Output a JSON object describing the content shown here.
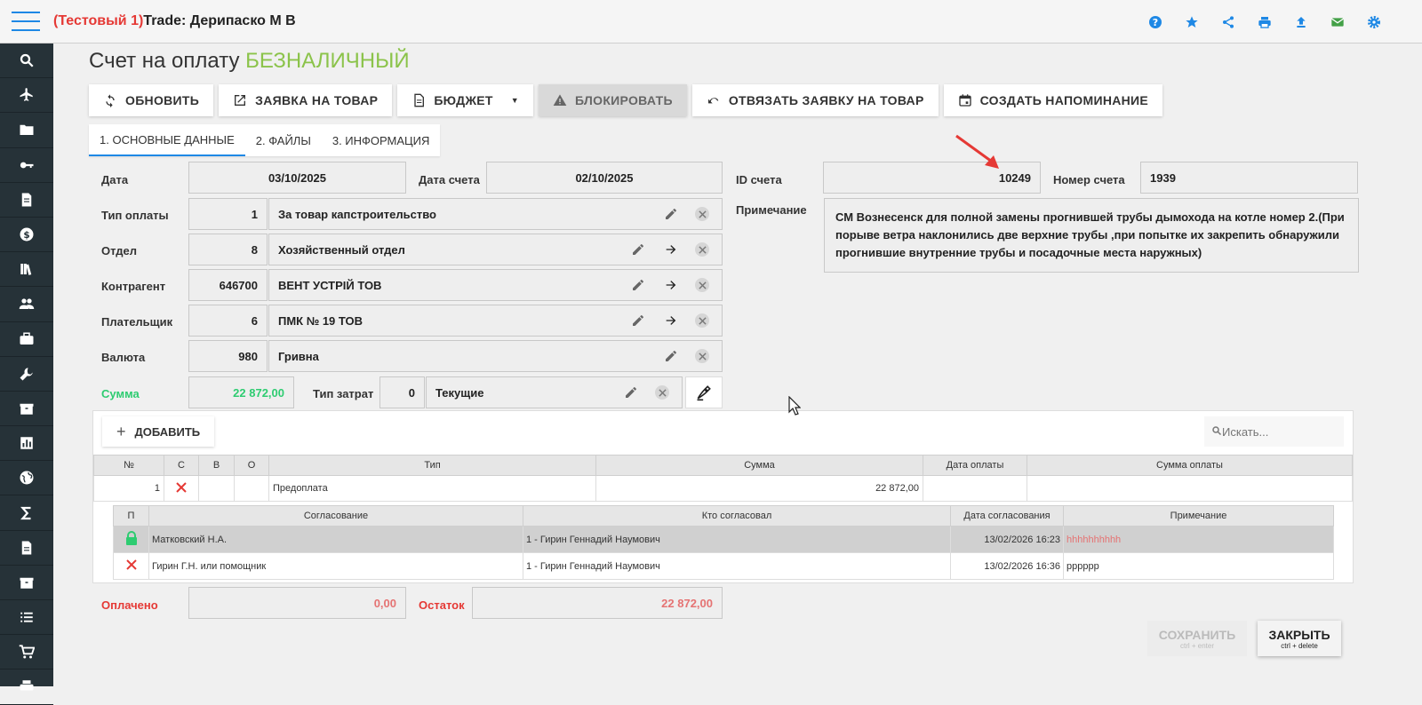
{
  "app": {
    "test_label": "(Тестовый 1)",
    "title": "Trade: Дерипаско М В"
  },
  "top_icons": [
    "help-icon",
    "star-icon",
    "share-icon",
    "print-icon",
    "upload-icon",
    "mail-icon",
    "settings-icon"
  ],
  "sidebar_icons": [
    "search-icon",
    "plane-icon",
    "folder-icon",
    "key-icon",
    "receipt-icon",
    "dollar-icon",
    "books-icon",
    "users-icon",
    "briefcase-icon",
    "wrench-icon",
    "box-icon",
    "chart-icon",
    "globe-icon",
    "sigma-icon",
    "document-icon",
    "box2-icon",
    "list-icon",
    "cart-icon",
    "print2-icon"
  ],
  "page": {
    "title": "Счет на оплату ",
    "subtitle": "БЕЗНАЛИЧНЫЙ"
  },
  "toolbar": {
    "refresh": "ОБНОВИТЬ",
    "request": "ЗАЯВКА НА ТОВАР",
    "budget": "БЮДЖЕТ",
    "block": "БЛОКИРОВАТЬ",
    "unlink": "ОТВЯЗАТЬ ЗАЯВКУ НА ТОВАР",
    "reminder": "СОЗДАТЬ НАПОМИНАНИЕ"
  },
  "tabs": [
    "1. ОСНОВНЫЕ ДАННЫЕ",
    "2. ФАЙЛЫ",
    "3. ИНФОРМАЦИЯ"
  ],
  "form": {
    "date_label": "Дата",
    "date": "03/10/2025",
    "invoice_date_label": "Дата счета",
    "invoice_date": "02/10/2025",
    "id_label": "ID счета",
    "id": "10249",
    "number_label": "Номер счета",
    "number": "1939",
    "note_label": "Примечание",
    "note": "СМ Вознесенск для полной замены прогнившей трубы дымохода на котле номер 2.(При порыве ветра наклонились две верхние трубы ,при попытке их закрепить обнаружили прогнившие внутренние трубы и посадочные места наружных)",
    "pay_type_label": "Тип оплаты",
    "pay_type_code": "1",
    "pay_type": "За товар капстроительство",
    "dept_label": "Отдел",
    "dept_code": "8",
    "dept": "Хозяйственный отдел",
    "contractor_label": "Контрагент",
    "contractor_code": "646700",
    "contractor": "ВЕНТ УСТРІЙ ТОВ",
    "payer_label": "Плательщик",
    "payer_code": "6",
    "payer": "ПМК № 19 ТОВ",
    "currency_label": "Валюта",
    "currency_code": "980",
    "currency": "Гривна",
    "sum_label": "Сумма",
    "sum": "22 872,00",
    "cost_type_label": "Тип затрат",
    "cost_type_code": "0",
    "cost_type": "Текущие"
  },
  "grid": {
    "add": "ДОБАВИТЬ",
    "search_placeholder": "Искать...",
    "headers": [
      "№",
      "С",
      "В",
      "О",
      "Тип",
      "Сумма",
      "Дата оплаты",
      "Сумма оплаты"
    ],
    "rows": [
      {
        "n": "1",
        "type": "Предоплата",
        "sum": "22 872,00",
        "pay_date": "",
        "pay_sum": ""
      }
    ]
  },
  "approvals": {
    "headers": [
      "П",
      "Согласование",
      "Кто согласовал",
      "Дата согласования",
      "Примечание"
    ],
    "rows": [
      {
        "who": "Матковский Н.А.",
        "by": "1 - Гирин Геннадий Наумович",
        "date": "13/02/2026 16:23",
        "note": "hhhhhhhhhh"
      },
      {
        "who": "Гирин Г.Н. или помощник",
        "by": "1 - Гирин Геннадий Наумович",
        "date": "13/02/2026 16:36",
        "note": "pppppp"
      }
    ]
  },
  "totals": {
    "paid_label": "Оплачено",
    "paid": "0,00",
    "rest_label": "Остаток",
    "rest": "22 872,00"
  },
  "buttons": {
    "save": "СОХРАНИТЬ",
    "save_hint": "ctrl + enter",
    "close": "ЗАКРЫТЬ",
    "close_hint": "ctrl + delete"
  },
  "colors": {
    "accent": "#1e88e5",
    "sidebar": "#263238",
    "success": "#2ecc71",
    "danger": "#e53935",
    "subtitle": "#8bc34a"
  }
}
